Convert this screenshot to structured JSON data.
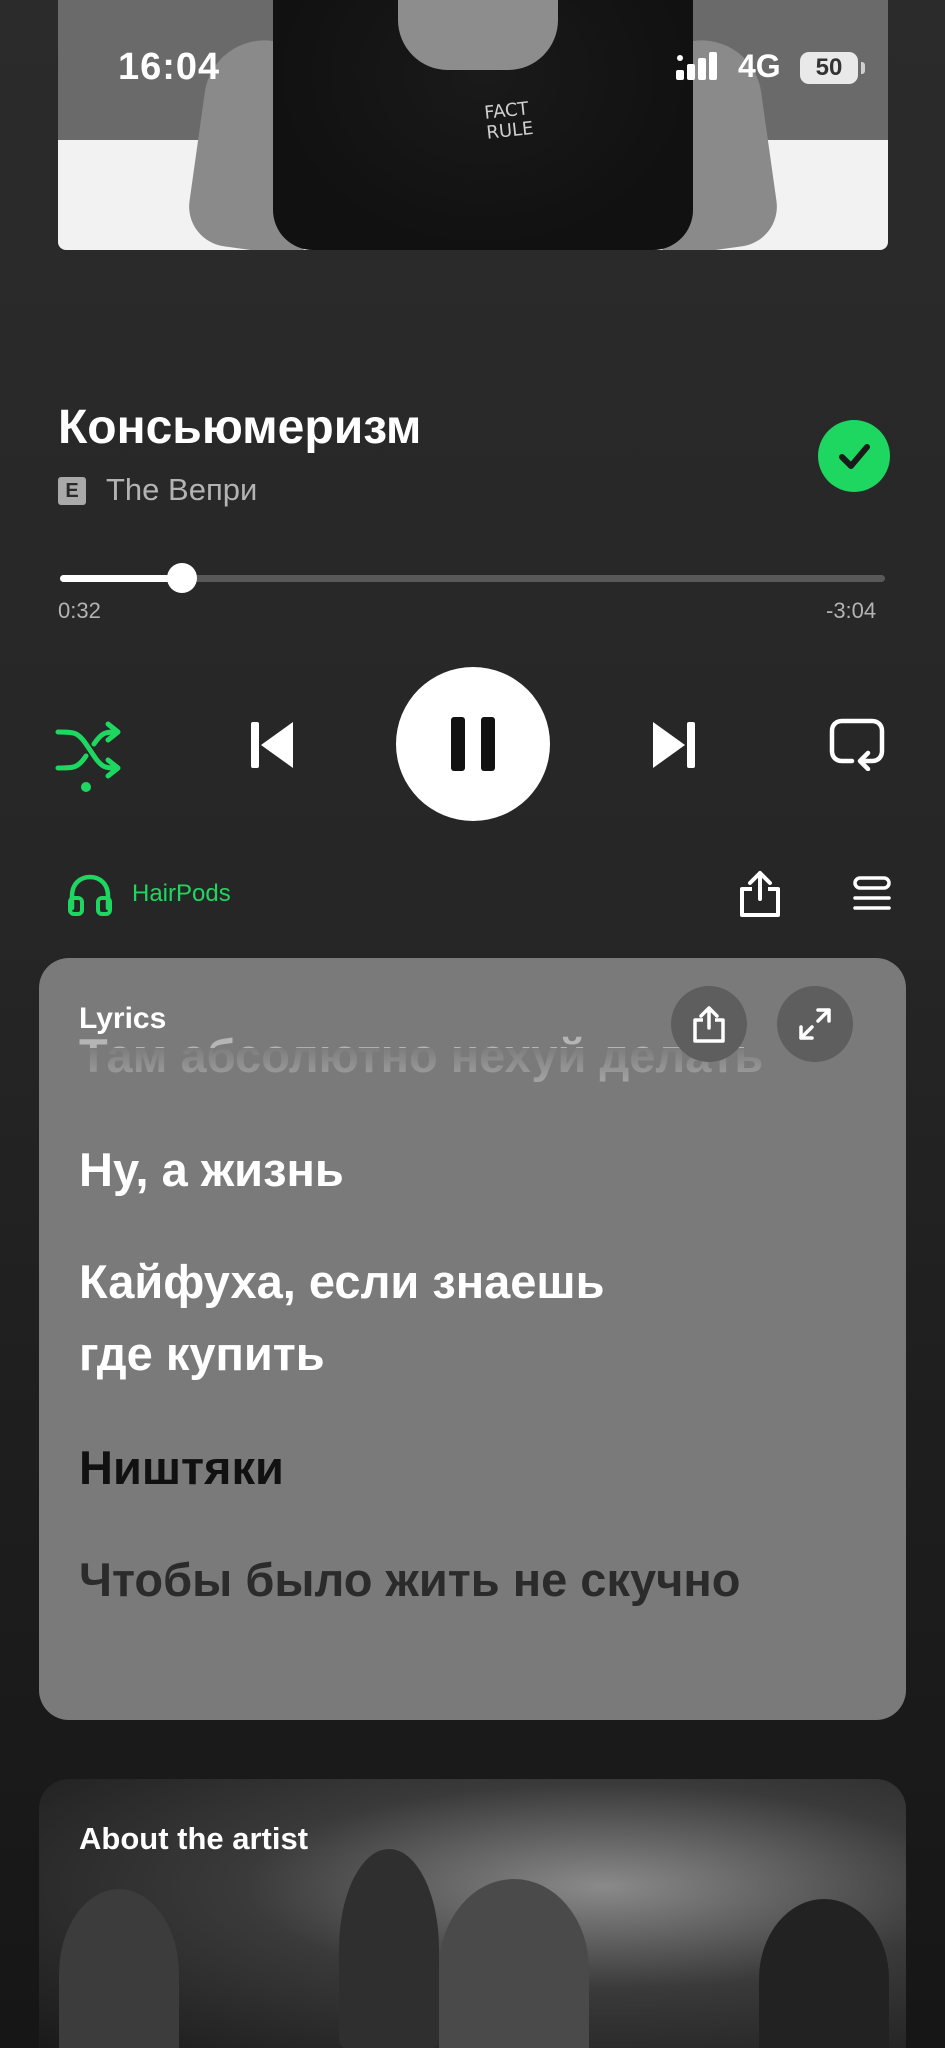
{
  "status_bar": {
    "time": "16:04",
    "network": "4G",
    "battery": "50"
  },
  "album_art": {
    "print_text": "FACT RULE"
  },
  "track": {
    "title": "Консьюмеризм",
    "explicit_badge": "E",
    "artist": "The Вепри",
    "liked": true
  },
  "progress": {
    "elapsed": "0:32",
    "remaining": "-3:04",
    "fraction": 0.148
  },
  "controls": {
    "shuffle_active": true,
    "state": "playing",
    "icons": [
      "shuffle-icon",
      "previous-icon",
      "pause-icon",
      "next-icon",
      "repeat-icon"
    ]
  },
  "device": {
    "name": "HairPods"
  },
  "lyrics": {
    "header": "Lyrics",
    "lines": [
      "Там абсолютно нехуй делать",
      "Ну, а жизнь",
      "Кайфуха, если знаешь где купить",
      "Ништяки",
      "Чтобы было жить не скучно"
    ]
  },
  "about": {
    "header": "About the artist"
  },
  "colors": {
    "accent": "#1ed760",
    "background": "#262626",
    "lyrics_card": "#7a7a7a"
  }
}
